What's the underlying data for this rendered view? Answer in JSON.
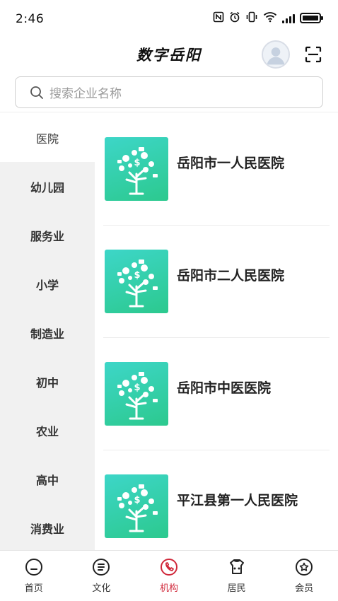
{
  "status_bar": {
    "time": "2:46",
    "icons": [
      "nfc-icon",
      "alarm-icon",
      "vibrate-icon",
      "wifi-icon",
      "signal-icon",
      "battery-icon"
    ]
  },
  "header": {
    "title": "数字岳阳",
    "avatar_icon": "user-avatar-icon",
    "scan_icon": "scan-icon"
  },
  "search": {
    "placeholder": "搜索企业名称"
  },
  "sidebar": {
    "items": [
      {
        "label": "医院",
        "active": true
      },
      {
        "label": "幼儿园",
        "active": false
      },
      {
        "label": "服务业",
        "active": false
      },
      {
        "label": "小学",
        "active": false
      },
      {
        "label": "制造业",
        "active": false
      },
      {
        "label": "初中",
        "active": false
      },
      {
        "label": "农业",
        "active": false
      },
      {
        "label": "高中",
        "active": false
      },
      {
        "label": "消费业",
        "active": false
      }
    ]
  },
  "list": {
    "items": [
      {
        "name": "岳阳市一人民医院"
      },
      {
        "name": "岳阳市二人民医院"
      },
      {
        "name": "岳阳市中医医院"
      },
      {
        "name": "平江县第一人民医院"
      }
    ]
  },
  "bottom_nav": {
    "items": [
      {
        "label": "首页",
        "icon": "home-icon"
      },
      {
        "label": "文化",
        "icon": "document-icon"
      },
      {
        "label": "机构",
        "icon": "phone-icon",
        "active": true
      },
      {
        "label": "居民",
        "icon": "resident-icon"
      },
      {
        "label": "会员",
        "icon": "star-badge-icon"
      }
    ]
  },
  "colors": {
    "accent": "#d0283a",
    "thumb_gradient_start": "#3dd6c8",
    "thumb_gradient_end": "#2cc98e",
    "sidebar_bg": "#f1f1f1"
  }
}
